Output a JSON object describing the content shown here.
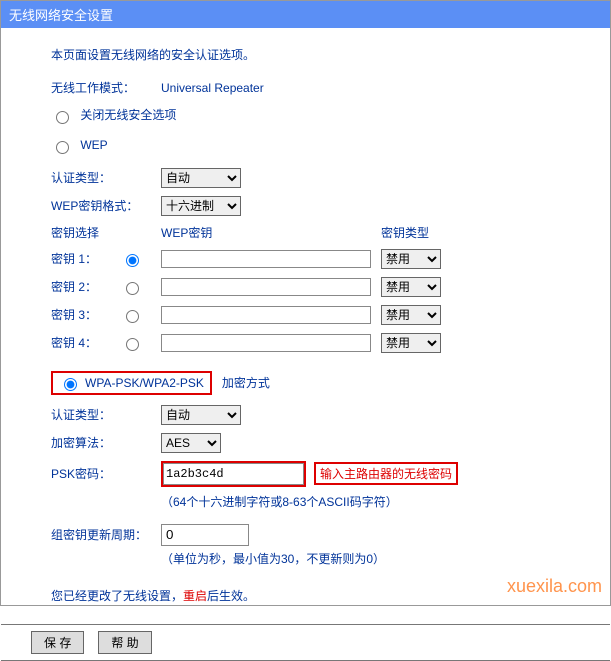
{
  "title": "无线网络安全设置",
  "desc": "本页面设置无线网络的安全认证选项。",
  "mode_label": "无线工作模式：",
  "mode_value": "Universal Repeater",
  "opt_disable": "关闭无线安全选项",
  "opt_wep": "WEP",
  "auth_label": "认证类型：",
  "auth_value": "自动",
  "wep_format_label": "WEP密钥格式：",
  "wep_format_value": "十六进制",
  "key_select": "密钥选择",
  "wep_key": "WEP密钥",
  "key_type": "密钥类型",
  "keys": [
    {
      "label": "密钥 1：",
      "type": "禁用"
    },
    {
      "label": "密钥 2：",
      "type": "禁用"
    },
    {
      "label": "密钥 3：",
      "type": "禁用"
    },
    {
      "label": "密钥 4：",
      "type": "禁用"
    }
  ],
  "opt_wpa": "WPA-PSK/WPA2-PSK",
  "encrypt_label": "加密方式",
  "auth2_label": "认证类型：",
  "auth2_value": "自动",
  "algo_label": "加密算法：",
  "algo_value": "AES",
  "psk_label": "PSK密码：",
  "psk_value": "1a2b3c4d",
  "psk_hint": "输入主路由器的无线密码",
  "psk_note": "（64个十六进制字符或8-63个ASCII码字符）",
  "group_label": "组密钥更新周期：",
  "group_value": "0",
  "group_note": "（单位为秒，最小值为30，不更新则为0）",
  "reboot1": "您已经更改了无线设置，",
  "reboot2": "重启",
  "reboot3": "后生效。",
  "btn_save": "保 存",
  "btn_help": "帮 助",
  "watermark": "xuexila.com"
}
